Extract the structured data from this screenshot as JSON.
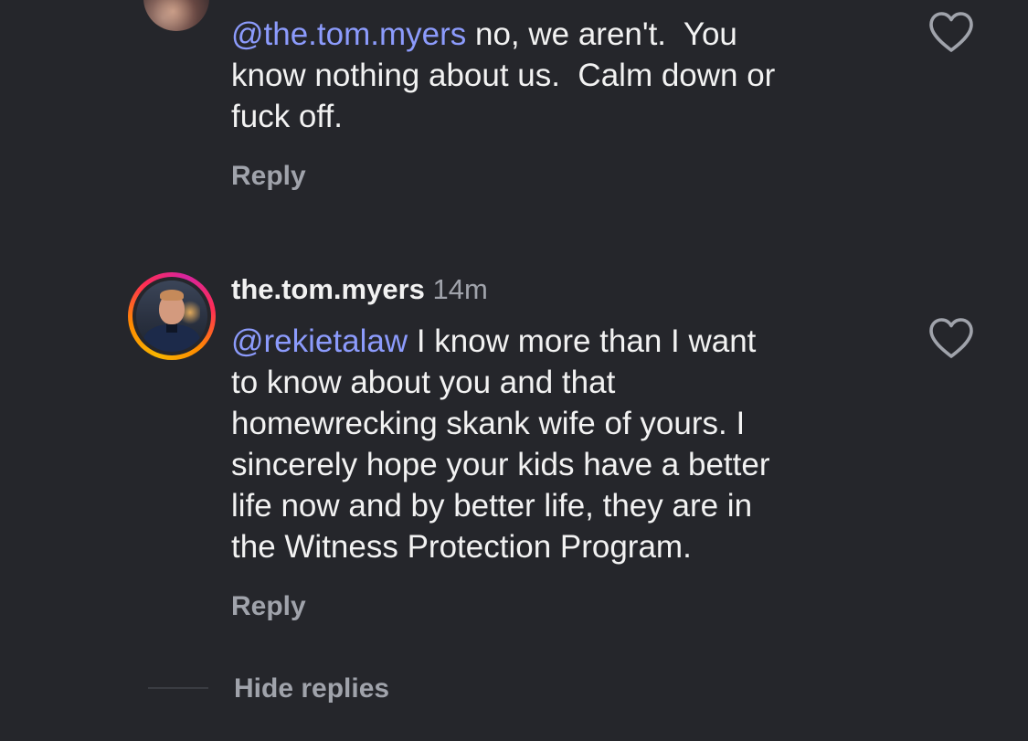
{
  "comments": [
    {
      "text_lines": [
        {
          "mention": "@the.tom.myers",
          "rest": " no, we aren't.  You"
        },
        {
          "mention": "",
          "rest": "know nothing about us.  Calm down or"
        },
        {
          "mention": "",
          "rest": "fuck off."
        }
      ],
      "reply_label": "Reply",
      "like_icon": "heart-outline-icon"
    },
    {
      "username": "the.tom.myers",
      "timestamp": "14m",
      "text_lines": [
        {
          "mention": "@rekietalaw",
          "rest": " I know more than I want"
        },
        {
          "mention": "",
          "rest": "to know about you and that"
        },
        {
          "mention": "",
          "rest": "homewrecking skank wife of yours. I"
        },
        {
          "mention": "",
          "rest": "sincerely hope your kids have a better"
        },
        {
          "mention": "",
          "rest": "life now and by better life, they are in"
        },
        {
          "mention": "",
          "rest": "the Witness Protection Program."
        }
      ],
      "reply_label": "Reply",
      "like_icon": "heart-outline-icon",
      "story_ring_colors": [
        "#f7b500",
        "#ff8a00",
        "#ff2d55",
        "#d6249f"
      ]
    }
  ],
  "thread": {
    "hide_replies_label": "Hide replies"
  },
  "colors": {
    "background": "#25262b",
    "text": "#f2f2f2",
    "mention": "#8c9bfc",
    "secondary": "#a0a3ab"
  }
}
